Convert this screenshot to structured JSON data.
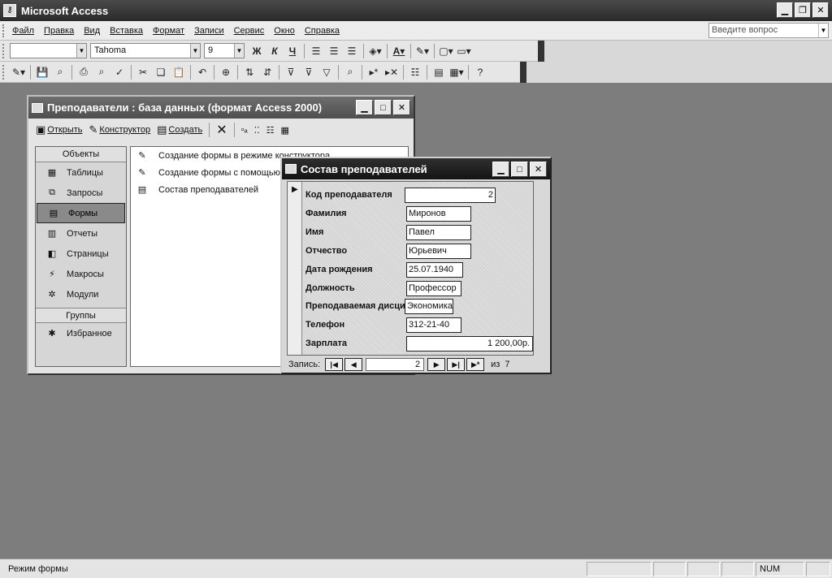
{
  "app": {
    "title": "Microsoft Access"
  },
  "menu": {
    "items": [
      "Файл",
      "Правка",
      "Вид",
      "Вставка",
      "Формат",
      "Записи",
      "Сервис",
      "Окно",
      "Справка"
    ],
    "help_placeholder": "Введите вопрос"
  },
  "toolbar": {
    "font_name": "Tahoma",
    "font_size": "9",
    "bold": "Ж",
    "italic": "К",
    "underline": "Ч"
  },
  "db_window": {
    "title": "Преподаватели : база данных (формат Access 2000)",
    "toolbar": {
      "open": "Открыть",
      "designer": "Конструктор",
      "create": "Создать"
    },
    "objects_header": "Объекты",
    "objects": [
      "Таблицы",
      "Запросы",
      "Формы",
      "Отчеты",
      "Страницы",
      "Макросы",
      "Модули"
    ],
    "groups_header": "Группы",
    "groups": [
      "Избранное"
    ],
    "list": [
      "Создание формы в режиме конструктора",
      "Создание формы с помощью мастера",
      "Состав преподавателей"
    ]
  },
  "form_window": {
    "title": "Состав преподавателей",
    "fields": [
      {
        "label": "Код преподавателя",
        "value": "2"
      },
      {
        "label": "Фамилия",
        "value": "Миронов"
      },
      {
        "label": "Имя",
        "value": "Павел"
      },
      {
        "label": "Отчество",
        "value": "Юрьевич"
      },
      {
        "label": "Дата рождения",
        "value": "25.07.1940"
      },
      {
        "label": "Должность",
        "value": "Профессор"
      },
      {
        "label": "Преподаваемая дисциплина",
        "value": "Экономика"
      },
      {
        "label": "Телефон",
        "value": "312-21-40"
      },
      {
        "label": "Зарплата",
        "value": "1 200,00р."
      }
    ],
    "nav": {
      "label": "Запись:",
      "current": "2",
      "of_label": "из",
      "total": "7"
    }
  },
  "statusbar": {
    "text": "Режим формы",
    "num": "NUM"
  }
}
